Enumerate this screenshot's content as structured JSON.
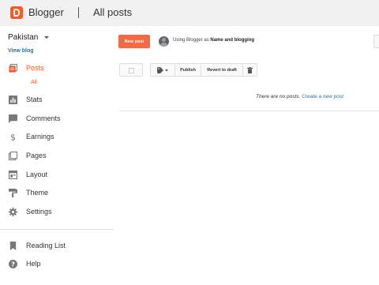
{
  "header": {
    "brand": "Blogger",
    "section_title": "All posts"
  },
  "sidebar": {
    "blog_name": "Pakistan",
    "view_blog": "View blog",
    "items": [
      {
        "label": "Posts",
        "icon": "posts-icon",
        "active": true
      },
      {
        "label": "Stats",
        "icon": "stats-icon"
      },
      {
        "label": "Comments",
        "icon": "comments-icon"
      },
      {
        "label": "Earnings",
        "icon": "dollar-icon"
      },
      {
        "label": "Pages",
        "icon": "pages-icon"
      },
      {
        "label": "Layout",
        "icon": "layout-icon"
      },
      {
        "label": "Theme",
        "icon": "theme-icon"
      },
      {
        "label": "Settings",
        "icon": "gear-icon"
      },
      {
        "label": "Reading List",
        "icon": "bookmark-icon"
      },
      {
        "label": "Help",
        "icon": "help-icon"
      }
    ],
    "sub_all": "All"
  },
  "main": {
    "new_post": "New post",
    "using_prefix": "Using Blogger as ",
    "using_name": "Name and blogging",
    "toolbar": {
      "publish": "Publish",
      "revert": "Revert to draft"
    },
    "empty_text": "There are no posts.",
    "create_link": "Create a new post"
  },
  "colors": {
    "accent": "#ff5722",
    "new_post_bg": "#f26a45",
    "link": "#1a73a8"
  }
}
